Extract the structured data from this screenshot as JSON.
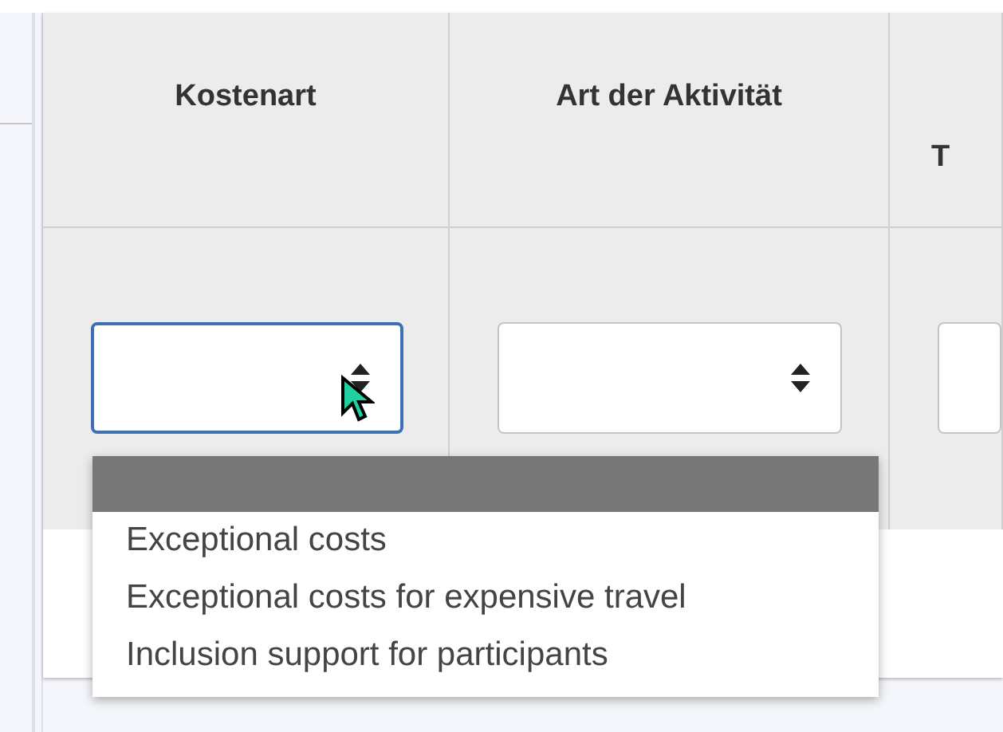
{
  "table": {
    "columns": [
      {
        "heading": "Kostenart"
      },
      {
        "heading": "Art der Aktivität"
      },
      {
        "heading": "T"
      }
    ],
    "selects": [
      {
        "focused": true
      },
      {
        "focused": false
      },
      {
        "focused": false
      }
    ]
  },
  "dropdown": {
    "options": [
      {
        "selected": true
      },
      {
        "label": "Exceptional costs",
        "selected": false
      },
      {
        "label": "Exceptional costs for expensive travel",
        "selected": false
      },
      {
        "label": "Inclusion support for participants",
        "selected": false
      }
    ]
  }
}
